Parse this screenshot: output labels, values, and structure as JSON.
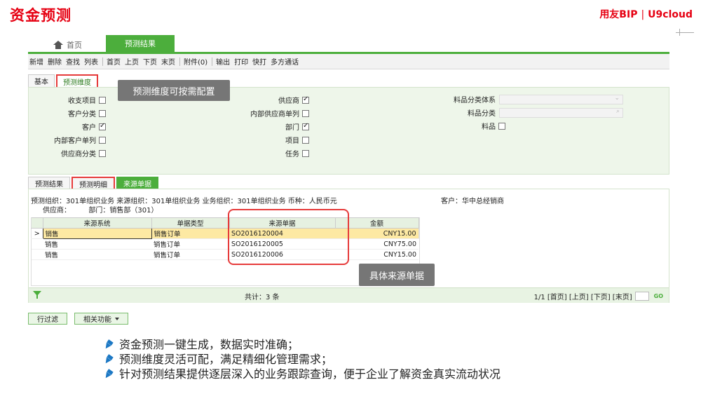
{
  "slide": {
    "title": "资金预测",
    "brand_left": "用友BIP",
    "brand_sep": "|",
    "brand_right": "U9cloud"
  },
  "top_tabs": {
    "home": "首页",
    "active": "预测结果"
  },
  "toolbar": [
    "新增",
    "删除",
    "查找",
    "列表",
    "首页",
    "上页",
    "下页",
    "末页",
    "附件(0)",
    "输出",
    "打印",
    "快打",
    "多方通话"
  ],
  "upper_tabs": [
    "基本",
    "预测维度"
  ],
  "tooltip_dims": "预测维度可按需配置",
  "dims": {
    "col1": [
      {
        "label": "收支项目",
        "checked": false
      },
      {
        "label": "客户分类",
        "checked": false
      },
      {
        "label": "客户",
        "checked": true
      },
      {
        "label": "内部客户单列",
        "checked": false
      },
      {
        "label": "供应商分类",
        "checked": false
      }
    ],
    "col2": [
      {
        "label": "供应商",
        "checked": true
      },
      {
        "label": "内部供应商单列",
        "checked": false
      },
      {
        "label": "部门",
        "checked": true
      },
      {
        "label": "项目",
        "checked": false
      },
      {
        "label": "任务",
        "checked": false
      }
    ],
    "col3": [
      {
        "label": "料品分类体系"
      },
      {
        "label": "料品分类"
      },
      {
        "label": "料品",
        "checked": false
      }
    ]
  },
  "lower_tabs": [
    "预测结果",
    "预测明细",
    "来源单据"
  ],
  "info": {
    "line1": "预测组织：301单组织业务  来源组织：301单组织业务  业务组织：301单组织业务  币种：人民币元",
    "customer": "客户：华中总经销商",
    "line2": "供应商：        部门：销售部（301）"
  },
  "grid": {
    "columns": [
      "来源系统",
      "单据类型",
      "来源单据",
      "金额"
    ],
    "rows": [
      {
        "system": "销售",
        "type": "销售订单",
        "doc": "SO2016120004",
        "amount": "CNY15.00"
      },
      {
        "system": "销售",
        "type": "销售订单",
        "doc": "SO2016120005",
        "amount": "CNY75.00"
      },
      {
        "system": "销售",
        "type": "销售订单",
        "doc": "SO2016120006",
        "amount": "CNY15.00"
      }
    ],
    "row_marker": ">"
  },
  "footer": {
    "total": "共计：3 条",
    "pager": "1/1 [首页] [上页] [下页] [末页]",
    "go": "GO"
  },
  "tooltip_source": "具体来源单据",
  "buttons": {
    "filter": "行过滤",
    "related": "相关功能"
  },
  "bullets": [
    "资金预测一键生成，数据实时准确；",
    "预测维度灵活可配，满足精细化管理需求；",
    "针对预测结果提供逐层深入的业务跟踪查询，便于企业了解资金真实流动状况"
  ],
  "colors": {
    "accent_red": "#e60012",
    "green": "#4cae3c",
    "bullet_blue": "#1c78c4"
  }
}
